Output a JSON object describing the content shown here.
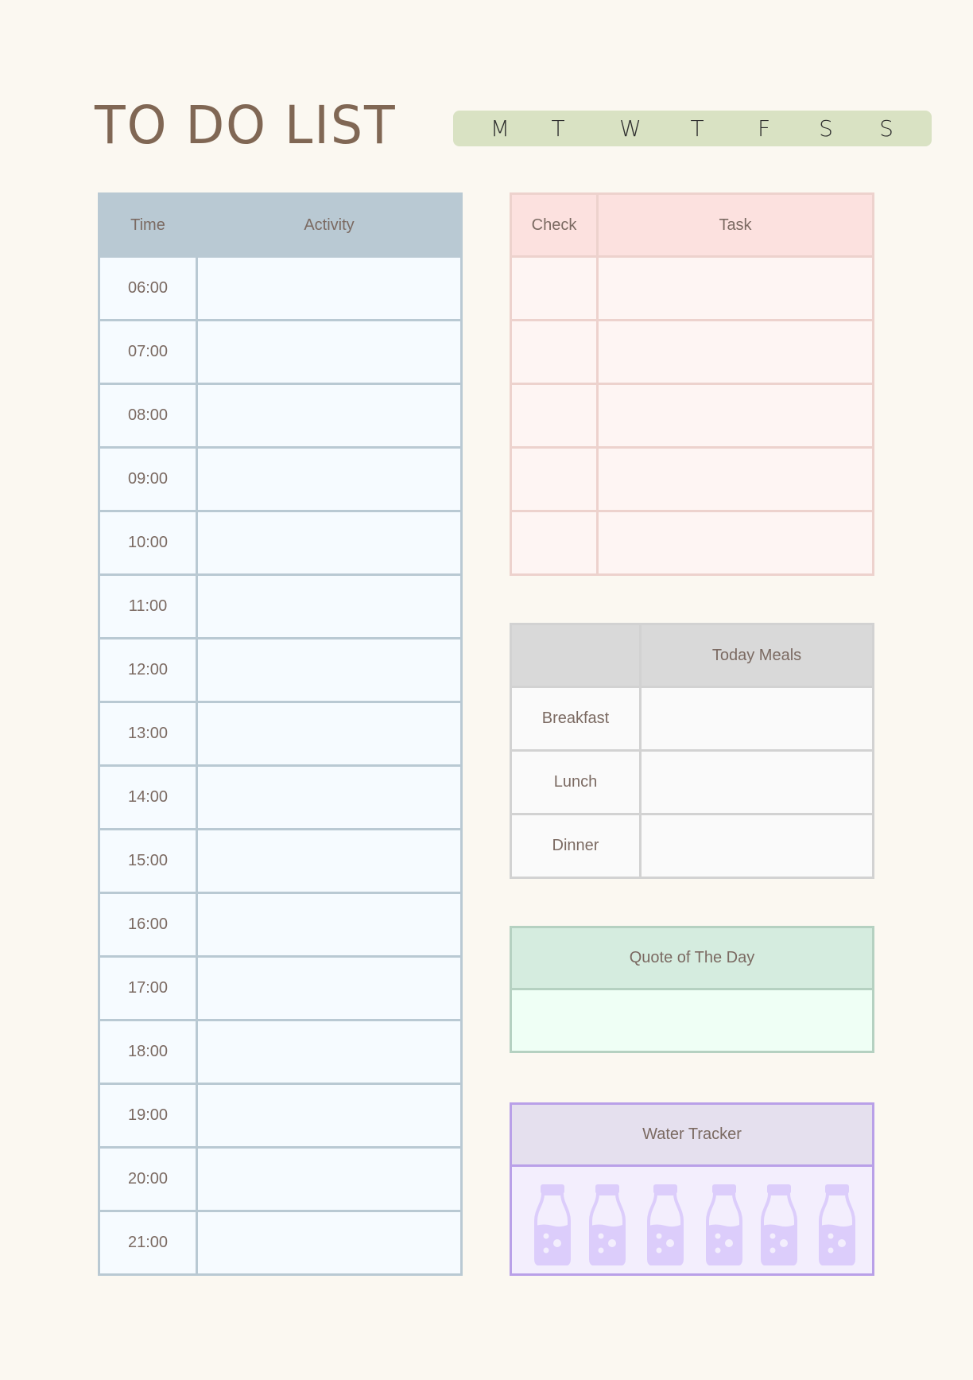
{
  "header": {
    "title": "TO DO LIST",
    "days": [
      "M",
      "T",
      "W",
      "T",
      "F",
      "S",
      "S"
    ]
  },
  "schedule": {
    "columns": [
      "Time",
      "Activity"
    ],
    "rows": [
      {
        "time": "06:00",
        "activity": ""
      },
      {
        "time": "07:00",
        "activity": ""
      },
      {
        "time": "08:00",
        "activity": ""
      },
      {
        "time": "09:00",
        "activity": ""
      },
      {
        "time": "10:00",
        "activity": ""
      },
      {
        "time": "11:00",
        "activity": ""
      },
      {
        "time": "12:00",
        "activity": ""
      },
      {
        "time": "13:00",
        "activity": ""
      },
      {
        "time": "14:00",
        "activity": ""
      },
      {
        "time": "15:00",
        "activity": ""
      },
      {
        "time": "16:00",
        "activity": ""
      },
      {
        "time": "17:00",
        "activity": ""
      },
      {
        "time": "18:00",
        "activity": ""
      },
      {
        "time": "19:00",
        "activity": ""
      },
      {
        "time": "20:00",
        "activity": ""
      },
      {
        "time": "21:00",
        "activity": ""
      }
    ]
  },
  "tasks": {
    "columns": [
      "Check",
      "Task"
    ],
    "rows": [
      {
        "check": "",
        "task": ""
      },
      {
        "check": "",
        "task": ""
      },
      {
        "check": "",
        "task": ""
      },
      {
        "check": "",
        "task": ""
      },
      {
        "check": "",
        "task": ""
      }
    ]
  },
  "meals": {
    "columns": [
      "",
      "Today Meals"
    ],
    "rows": [
      {
        "meal": "Breakfast",
        "value": ""
      },
      {
        "meal": "Lunch",
        "value": ""
      },
      {
        "meal": "Dinner",
        "value": ""
      }
    ]
  },
  "quote": {
    "title": "Quote of The Day",
    "text": ""
  },
  "water": {
    "title": "Water Tracker",
    "bottle_icon": "water-bottle-icon",
    "bottle_count": 6
  },
  "colors": {
    "background": "#fbf8f1",
    "title": "#806754",
    "days_bar": "#d9e2c3",
    "schedule_header": "#b9c9d3",
    "tasks_header": "#fce1df",
    "meals_header": "#d9d9d9",
    "quote_header": "#d5ecdf",
    "water_header": "#e5e0ee",
    "water_border": "#b9a0e8",
    "bottle": "#dccdfb"
  }
}
